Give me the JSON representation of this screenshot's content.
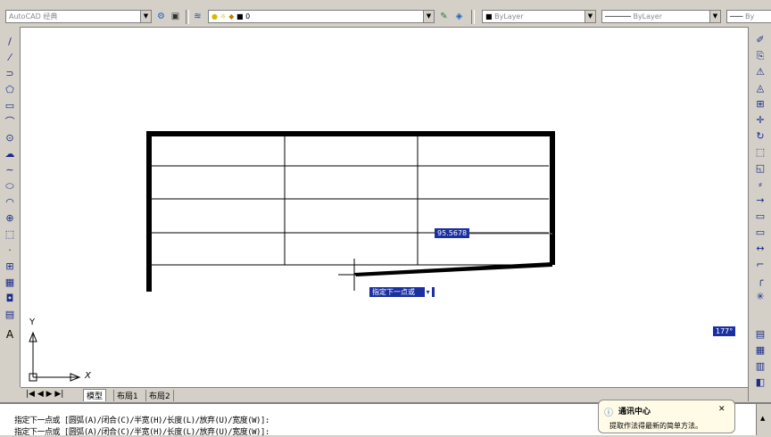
{
  "toolbar": {
    "workspace": "AutoCAD 经典",
    "layer": "0",
    "color": "ByLayer",
    "linetype": "ByLayer",
    "lineweight": "By"
  },
  "drawing": {
    "dimension_value": "95.5678",
    "prompt": "指定下一点或",
    "angle_value": "177°"
  },
  "ucs": {
    "y_label": "Y",
    "x_label": "X"
  },
  "tabs": {
    "nav": "|◀ ◀ ▶ ▶|",
    "items": [
      "模型",
      "布局1",
      "布局2"
    ]
  },
  "command": {
    "line1": "指定下一点或 [圆弧(A)/闭合(C)/半宽(H)/长度(L)/放弃(U)/宽度(W)]:",
    "line2": "指定下一点或 [圆弧(A)/闭合(C)/半宽(H)/长度(L)/放弃(U)/宽度(W)]:"
  },
  "notification": {
    "title": "通讯中心",
    "body": "提取作法得最新的简单方法。",
    "close": "✕"
  },
  "colors": {
    "canvas": "#ffffff",
    "dynamic_input": "#1a2fa0",
    "chrome": "#d4d0c8"
  }
}
